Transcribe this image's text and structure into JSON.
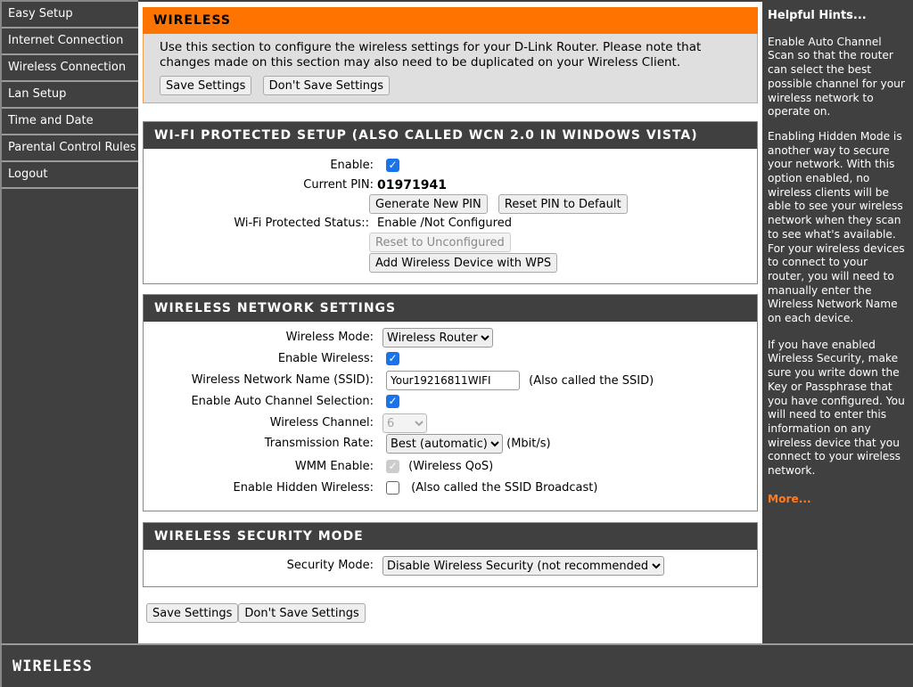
{
  "sidebar": {
    "items": [
      {
        "label": "Easy Setup"
      },
      {
        "label": "Internet Connection"
      },
      {
        "label": "Wireless Connection"
      },
      {
        "label": "Lan Setup"
      },
      {
        "label": "Time and Date"
      },
      {
        "label": "Parental Control Rules"
      },
      {
        "label": "Logout"
      }
    ]
  },
  "wireless": {
    "title": "WIRELESS",
    "description": "Use this section to configure the wireless settings for your D-Link Router. Please note that changes made on this section may also need to be duplicated on your Wireless Client.",
    "save_label": "Save Settings",
    "dont_save_label": "Don't Save Settings"
  },
  "wps": {
    "title": "WI-FI PROTECTED SETUP (ALSO CALLED WCN 2.0 IN WINDOWS VISTA)",
    "enable_label": "Enable:",
    "enable_checked": true,
    "pin_label": "Current PIN:",
    "pin": "01971941",
    "generate_label": "Generate New PIN",
    "reset_pin_label": "Reset PIN to Default",
    "status_label": "Wi-Fi Protected Status::",
    "status": "Enable /Not Configured",
    "reset_unconf_label": "Reset to Unconfigured",
    "add_device_label": "Add Wireless Device with WPS"
  },
  "network": {
    "title": "WIRELESS NETWORK SETTINGS",
    "mode_label": "Wireless Mode:",
    "mode": "Wireless Router",
    "enable_label": "Enable Wireless:",
    "enable_checked": true,
    "ssid_label": "Wireless Network Name (SSID):",
    "ssid": "Your19216811WIFI",
    "ssid_note": "(Also called the SSID)",
    "auto_label": "Enable Auto Channel Selection:",
    "auto_checked": true,
    "channel_label": "Wireless Channel:",
    "channel": "6",
    "rate_label": "Transmission Rate:",
    "rate": "Best (automatic)",
    "rate_unit": "(Mbit/s)",
    "wmm_label": "WMM Enable:",
    "wmm_checked": true,
    "wmm_note": "(Wireless QoS)",
    "hidden_label": "Enable Hidden Wireless:",
    "hidden_checked": false,
    "hidden_note": "(Also called the SSID Broadcast)"
  },
  "security": {
    "title": "WIRELESS SECURITY MODE",
    "mode_label": "Security Mode:",
    "mode": "Disable Wireless Security (not recommended)"
  },
  "bottom": {
    "save_label": "Save Settings",
    "dont_save_label": "Don't Save Settings"
  },
  "hints": {
    "title": "Helpful Hints...",
    "p1": "Enable Auto Channel Scan so that the router can select the best possible channel for your wireless network to operate on.",
    "p2": "Enabling Hidden Mode is another way to secure your network. With this option enabled, no wireless clients will be able to see your wireless network when they scan to see what's available. For your wireless devices to connect to your router, you will need to manually enter the Wireless Network Name on each device.",
    "p3": "If you have enabled Wireless Security, make sure you write down the Key or Passphrase that you have configured. You will need to enter this information on any wireless device that you connect to your wireless network.",
    "more": "More..."
  },
  "footer": {
    "logo": "WIRELESS"
  },
  "colors": {
    "accent": "#ff7400",
    "dark": "#404040",
    "checkbox": "#1a73e8"
  }
}
